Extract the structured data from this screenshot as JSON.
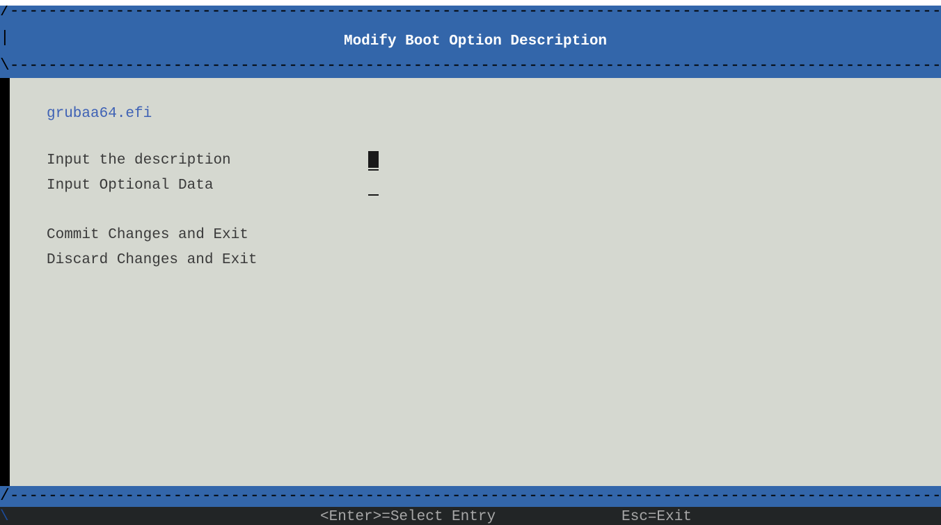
{
  "header": {
    "rule_top": "/------------------------------------------------------------------------------------------------------------",
    "bar_left": "|",
    "title": "Modify Boot Option Description",
    "rule_bottom": "\\-----------------------------------------------------------------------------------------------------------"
  },
  "content": {
    "filename": "grubaa64.efi",
    "fields": [
      {
        "label": "Input the description",
        "value": ""
      },
      {
        "label": "Input Optional Data",
        "value": ""
      }
    ],
    "actions": [
      {
        "label": "Commit Changes and Exit"
      },
      {
        "label": "Discard Changes and Exit"
      }
    ]
  },
  "footer": {
    "rule": "/------------------------------------------------------------------------------------------------------------",
    "corner": "\\",
    "enter_hint": "<Enter>=Select Entry",
    "esc_hint": "Esc=Exit"
  },
  "colors": {
    "header_bg": "#3366aa",
    "content_bg": "#d5d8d0",
    "filename": "#3f62b5",
    "text": "#3a3a3a",
    "status_bg": "#222526"
  }
}
